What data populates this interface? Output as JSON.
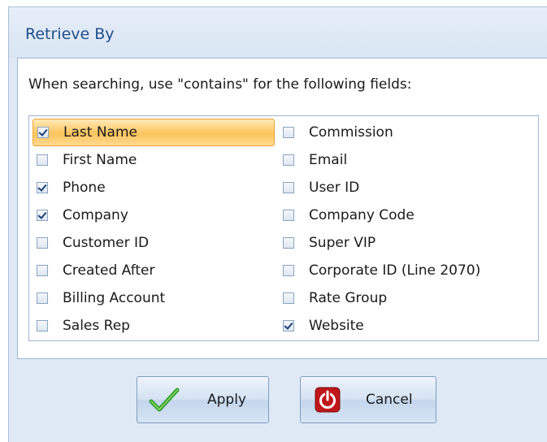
{
  "window": {
    "title": "Retrieve By"
  },
  "instruction": "When searching, use \"contains\" for the following fields:",
  "fields": {
    "left": [
      {
        "label": "Last Name",
        "checked": true,
        "highlighted": true
      },
      {
        "label": "First Name",
        "checked": false
      },
      {
        "label": "Phone",
        "checked": true
      },
      {
        "label": "Company",
        "checked": true
      },
      {
        "label": "Customer ID",
        "checked": false
      },
      {
        "label": "Created After",
        "checked": false
      },
      {
        "label": "Billing Account",
        "checked": false
      },
      {
        "label": "Sales Rep",
        "checked": false
      }
    ],
    "right": [
      {
        "label": "Commission",
        "checked": false
      },
      {
        "label": "Email",
        "checked": false
      },
      {
        "label": "User ID",
        "checked": false
      },
      {
        "label": "Company Code",
        "checked": false
      },
      {
        "label": "Super VIP",
        "checked": false
      },
      {
        "label": "Corporate ID (Line 2070)",
        "checked": false
      },
      {
        "label": "Rate Group",
        "checked": false
      },
      {
        "label": "Website",
        "checked": true
      }
    ]
  },
  "buttons": {
    "apply": {
      "label": "Apply",
      "icon": "checkmark-icon"
    },
    "cancel": {
      "label": "Cancel",
      "icon": "power-icon"
    }
  },
  "colors": {
    "title": "#1e4e8c",
    "highlight": "#fcc45c",
    "dialog_bg": "#dfe9f5"
  }
}
